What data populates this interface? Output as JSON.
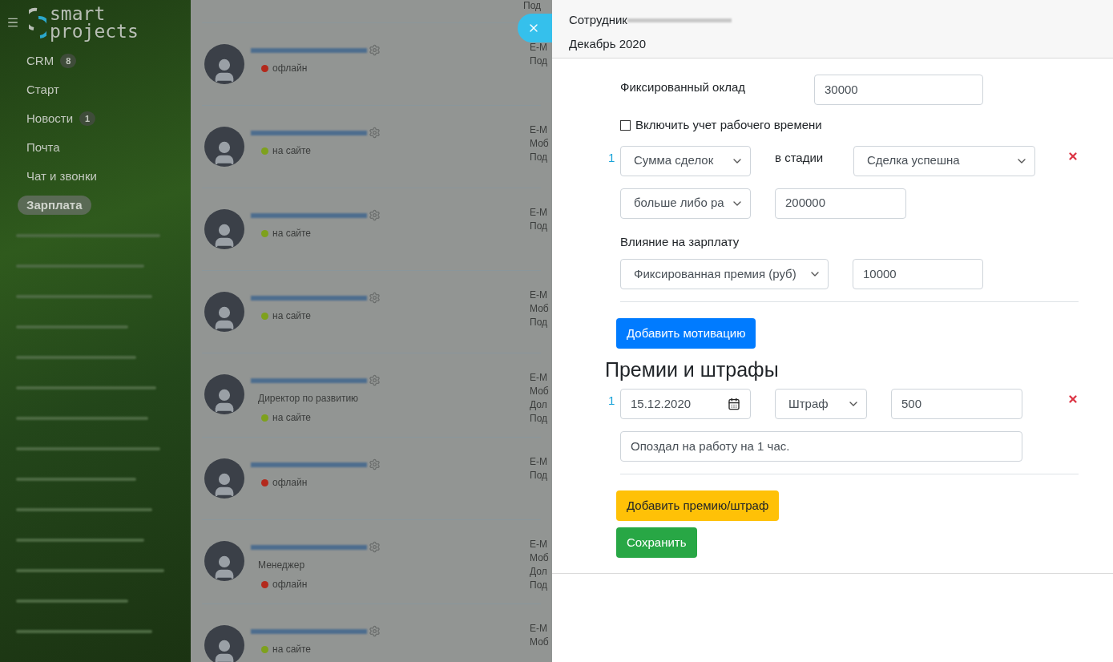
{
  "sidebar": {
    "logo": [
      "smart",
      "projects"
    ],
    "items": [
      {
        "label": "CRM",
        "badge": "8",
        "selected": false
      },
      {
        "label": "Старт",
        "selected": false
      },
      {
        "label": "Новости",
        "badge": "1",
        "selected": false
      },
      {
        "label": "Почта",
        "selected": false
      },
      {
        "label": "Чат и звонки",
        "selected": false
      },
      {
        "label": "Зарплата",
        "selected": true
      }
    ]
  },
  "employees_partial_row": {
    "details": [
      "Под"
    ]
  },
  "employees": [
    {
      "status": {
        "kind": "offline",
        "label": "офлайн"
      },
      "details": [
        "E-M",
        "Под"
      ]
    },
    {
      "status": {
        "kind": "online",
        "label": "на сайте"
      },
      "details": [
        "E-M",
        "Моб",
        "Под"
      ]
    },
    {
      "status": {
        "kind": "online",
        "label": "на сайте"
      },
      "details": [
        "E-M",
        "Под"
      ]
    },
    {
      "status": {
        "kind": "online",
        "label": "на сайте"
      },
      "details": [
        "E-M",
        "Моб",
        "Под"
      ]
    },
    {
      "position": "Директор по развитию",
      "status": {
        "kind": "online",
        "label": "на сайте"
      },
      "details": [
        "E-M",
        "Моб",
        "Дол",
        "Под"
      ]
    },
    {
      "status": {
        "kind": "offline",
        "label": "офлайн"
      },
      "details": [
        "E-M",
        "Под"
      ]
    },
    {
      "position": "Менеджер",
      "status": {
        "kind": "offline",
        "label": "офлайн"
      },
      "details": [
        "E-M",
        "Моб",
        "Дол",
        "Под"
      ]
    },
    {
      "status": {
        "kind": "online",
        "label": "на сайте"
      },
      "details": [
        "E-M",
        "Моб"
      ]
    }
  ],
  "panel": {
    "header": {
      "employee_label": "Сотрудник",
      "period": "Декабрь 2020"
    },
    "salary": {
      "label": "Фиксированный оклад",
      "value": "30000"
    },
    "time_tracking": {
      "label": "Включить учет рабочего времени",
      "checked": false
    },
    "motivations": [
      {
        "index": "1",
        "metric": "Сумма сделок",
        "stage_label": "в стадии",
        "stage": "Сделка успешна",
        "condition": "больше либо ра",
        "threshold": "200000",
        "impact_label": "Влияние на зарплату",
        "impact_type": "Фиксированная премия (руб)",
        "impact_value": "10000"
      }
    ],
    "add_motivation": "Добавить мотивацию",
    "bonuses_title": "Премии и штрафы",
    "bonuses": [
      {
        "index": "1",
        "date": "15.12.2020",
        "type": "Штраф",
        "amount": "500",
        "comment": "Опоздал на работу на 1 час."
      }
    ],
    "add_bonus": "Добавить премию/штраф",
    "save": "Сохранить"
  }
}
